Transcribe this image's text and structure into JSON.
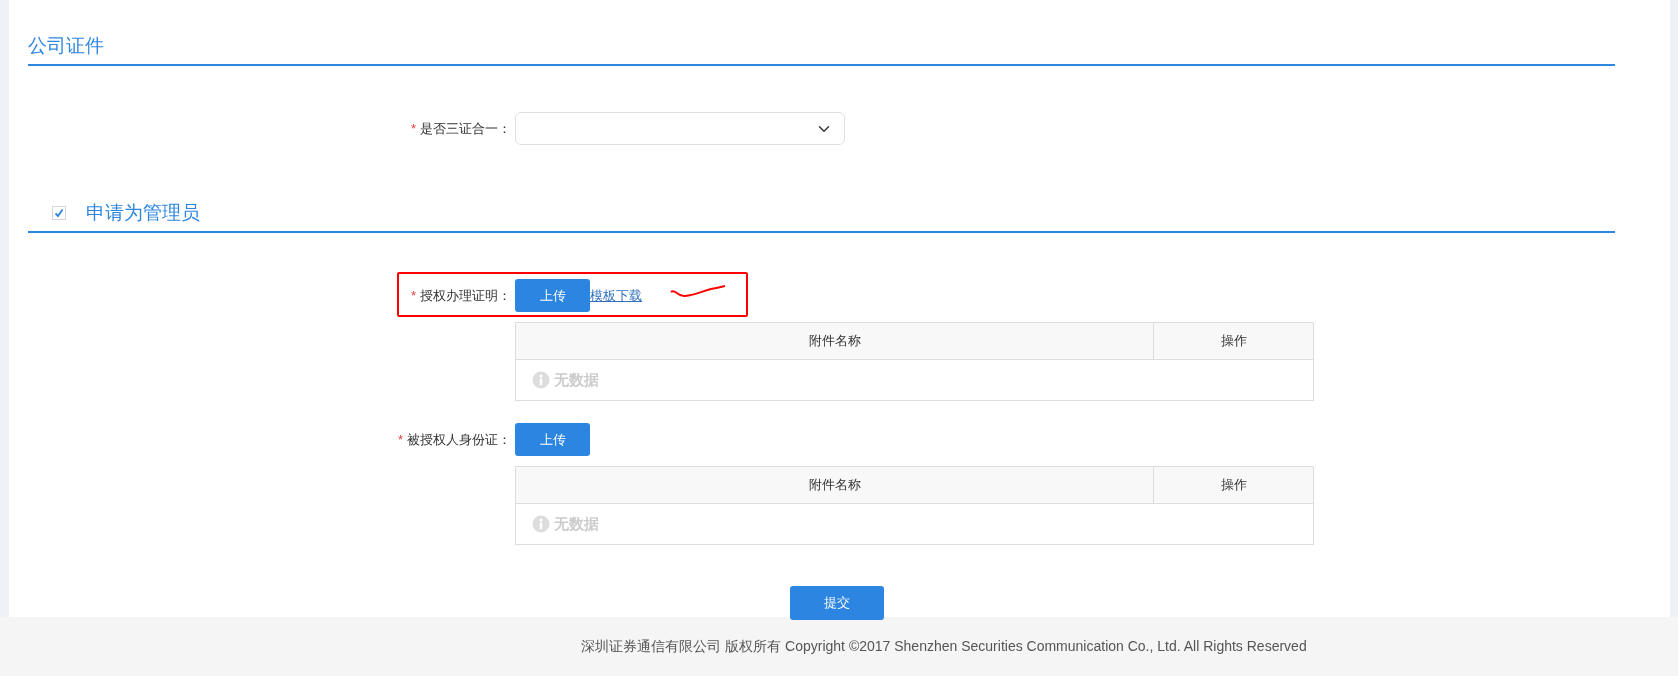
{
  "sections": [
    {
      "title": "公司证件",
      "fields": [
        {
          "kind": "select",
          "label": "是否三证合一：",
          "required_mark": "*"
        }
      ]
    },
    {
      "title": "申请为管理员",
      "checkbox": {
        "checked": true
      },
      "fields": [
        {
          "kind": "upload",
          "label": "授权办理证明：",
          "required_mark": "*",
          "button": "上传",
          "link": "模板下载",
          "highlighted": true,
          "table": {
            "columns": [
              "附件名称",
              "操作"
            ],
            "empty_text": "无数据"
          }
        },
        {
          "kind": "upload",
          "label": "被授权人身份证：",
          "required_mark": "*",
          "button": "上传",
          "highlighted": false,
          "table": {
            "columns": [
              "附件名称",
              "操作"
            ],
            "empty_text": "无数据"
          }
        }
      ]
    }
  ],
  "submit": "提交",
  "footer": "深圳证券通信有限公司 版权所有 Copyright ©2017 Shenzhen Securities Communication Co., Ltd. All Rights Reserved"
}
